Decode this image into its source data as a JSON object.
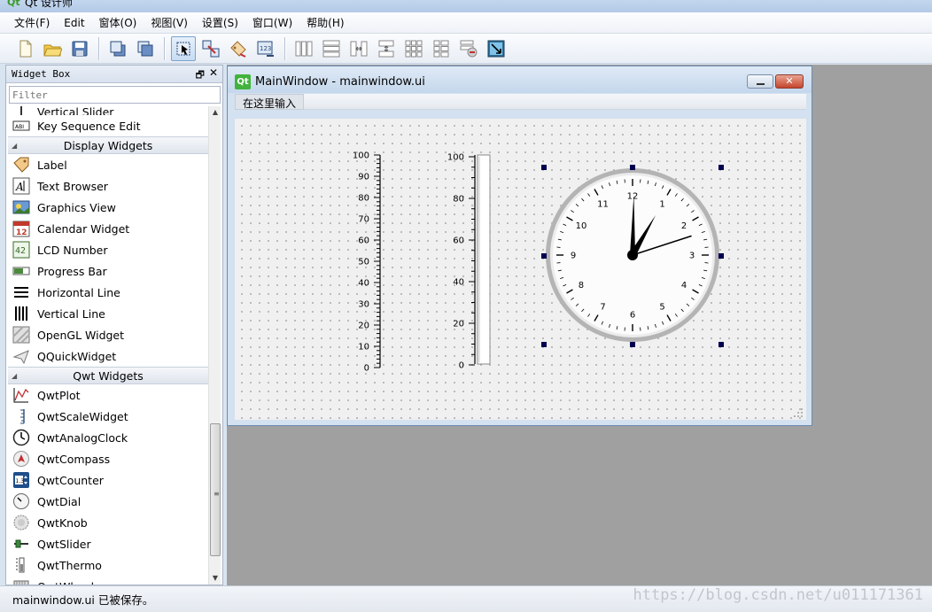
{
  "window": {
    "title": "Qt 设计师"
  },
  "menubar": {
    "items": [
      "文件(F)",
      "Edit",
      "窗体(O)",
      "视图(V)",
      "设置(S)",
      "窗口(W)",
      "帮助(H)"
    ]
  },
  "toolbar": {
    "buttons": [
      {
        "name": "new-form-icon"
      },
      {
        "name": "open-form-icon"
      },
      {
        "name": "save-form-icon"
      },
      {
        "sep": true
      },
      {
        "name": "send-to-back-icon"
      },
      {
        "name": "bring-to-front-icon"
      },
      {
        "sep": true
      },
      {
        "name": "edit-widgets-icon",
        "active": true
      },
      {
        "name": "edit-signals-slots-icon"
      },
      {
        "name": "edit-buddies-icon"
      },
      {
        "name": "edit-tab-order-icon"
      },
      {
        "sep": true
      },
      {
        "name": "lay-out-horizontally-icon"
      },
      {
        "name": "lay-out-vertically-icon"
      },
      {
        "name": "lay-out-horizontal-splitter-icon"
      },
      {
        "name": "lay-out-vertical-splitter-icon"
      },
      {
        "name": "lay-out-grid-icon"
      },
      {
        "name": "lay-out-form-icon"
      },
      {
        "name": "break-layout-icon"
      },
      {
        "name": "adjust-size-icon"
      }
    ]
  },
  "widget_box": {
    "title": "Widget Box",
    "float_glyph": "🗗",
    "close_glyph": "✕",
    "filter_placeholder": "Filter",
    "partial_top": "Vertical Slider",
    "items_before": [
      {
        "label": "Key Sequence Edit",
        "icon": "key-sequence-edit-icon"
      }
    ],
    "categories": [
      {
        "label": "Display Widgets",
        "items": [
          {
            "label": "Label",
            "icon": "label-icon"
          },
          {
            "label": "Text Browser",
            "icon": "text-browser-icon"
          },
          {
            "label": "Graphics View",
            "icon": "graphics-view-icon"
          },
          {
            "label": "Calendar Widget",
            "icon": "calendar-widget-icon"
          },
          {
            "label": "LCD Number",
            "icon": "lcd-number-icon"
          },
          {
            "label": "Progress Bar",
            "icon": "progress-bar-icon"
          },
          {
            "label": "Horizontal Line",
            "icon": "horizontal-line-icon"
          },
          {
            "label": "Vertical Line",
            "icon": "vertical-line-icon"
          },
          {
            "label": "OpenGL Widget",
            "icon": "opengl-widget-icon"
          },
          {
            "label": "QQuickWidget",
            "icon": "qquickwidget-icon"
          }
        ]
      },
      {
        "label": "Qwt Widgets",
        "items": [
          {
            "label": "QwtPlot",
            "icon": "qwtplot-icon"
          },
          {
            "label": "QwtScaleWidget",
            "icon": "qwtscalewidget-icon"
          },
          {
            "label": "QwtAnalogClock",
            "icon": "qwtanalogclock-icon"
          },
          {
            "label": "QwtCompass",
            "icon": "qwtcompass-icon"
          },
          {
            "label": "QwtCounter",
            "icon": "qwtcounter-icon"
          },
          {
            "label": "QwtDial",
            "icon": "qwtdial-icon"
          },
          {
            "label": "QwtKnob",
            "icon": "qwtknob-icon"
          },
          {
            "label": "QwtSlider",
            "icon": "qwtslider-icon"
          },
          {
            "label": "QwtThermo",
            "icon": "qwtthermo-icon"
          }
        ]
      }
    ],
    "partial_bottom": "QwtWheel"
  },
  "form": {
    "title": "MainWindow - mainwindow.ui",
    "close_glyph": "✕",
    "menu_placeholder": "在这里输入",
    "scale_widget": {
      "labels": [
        "100",
        "90",
        "80",
        "70",
        "60",
        "50",
        "40",
        "30",
        "20",
        "10",
        "0"
      ]
    },
    "thermo": {
      "labels": [
        "100",
        "80",
        "60",
        "40",
        "20",
        "0"
      ]
    },
    "clock": {
      "numbers": [
        "12",
        "1",
        "2",
        "3",
        "4",
        "5",
        "6",
        "7",
        "8",
        "9",
        "10",
        "11"
      ],
      "time": {
        "hour": 1,
        "minute": 0,
        "second": 12
      }
    }
  },
  "statusbar": {
    "text": "mainwindow.ui 已被保存。",
    "watermark": "https://blog.csdn.net/u011171361"
  }
}
